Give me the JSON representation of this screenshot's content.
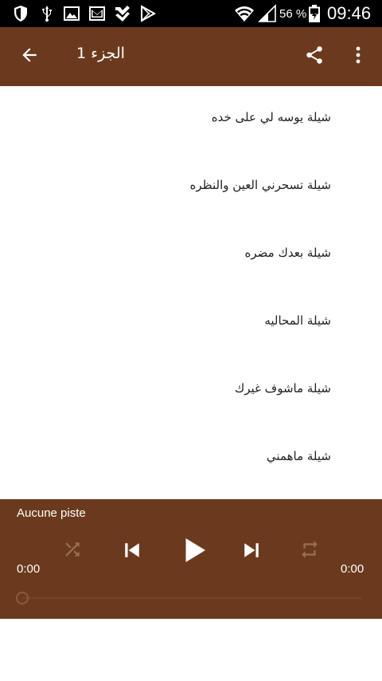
{
  "status_bar": {
    "battery_percent": "56 %",
    "time": "09:46",
    "icons": [
      "shield-icon",
      "usb-icon",
      "image-icon",
      "mail-icon",
      "download-check-icon",
      "play-store-icon",
      "wifi-icon",
      "signal-icon",
      "battery-icon"
    ]
  },
  "app_bar": {
    "title": "الجزء 1",
    "back_icon": "arrow-back-icon",
    "share_icon": "share-icon",
    "overflow_icon": "more-vert-icon"
  },
  "tracks": [
    {
      "label": "شيلة يوسه لي على خده"
    },
    {
      "label": "شيلة تسحرني العين والنظره"
    },
    {
      "label": "شيلة بعدك مضره"
    },
    {
      "label": "شيلة المحاليه"
    },
    {
      "label": "شيلة ماشوف غيرك"
    },
    {
      "label": "شيلة ماهمني"
    }
  ],
  "player": {
    "track_name": "Aucune piste",
    "elapsed": "0:00",
    "duration": "0:00",
    "progress": 0,
    "controls": [
      "shuffle-icon",
      "skip-previous-icon",
      "play-icon",
      "skip-next-icon",
      "repeat-icon"
    ]
  },
  "colors": {
    "status_bar": "#000000",
    "primary": "#6b3a1e",
    "background": "#ffffff",
    "text": "#222222",
    "disabled_icon": "#9a7050"
  }
}
